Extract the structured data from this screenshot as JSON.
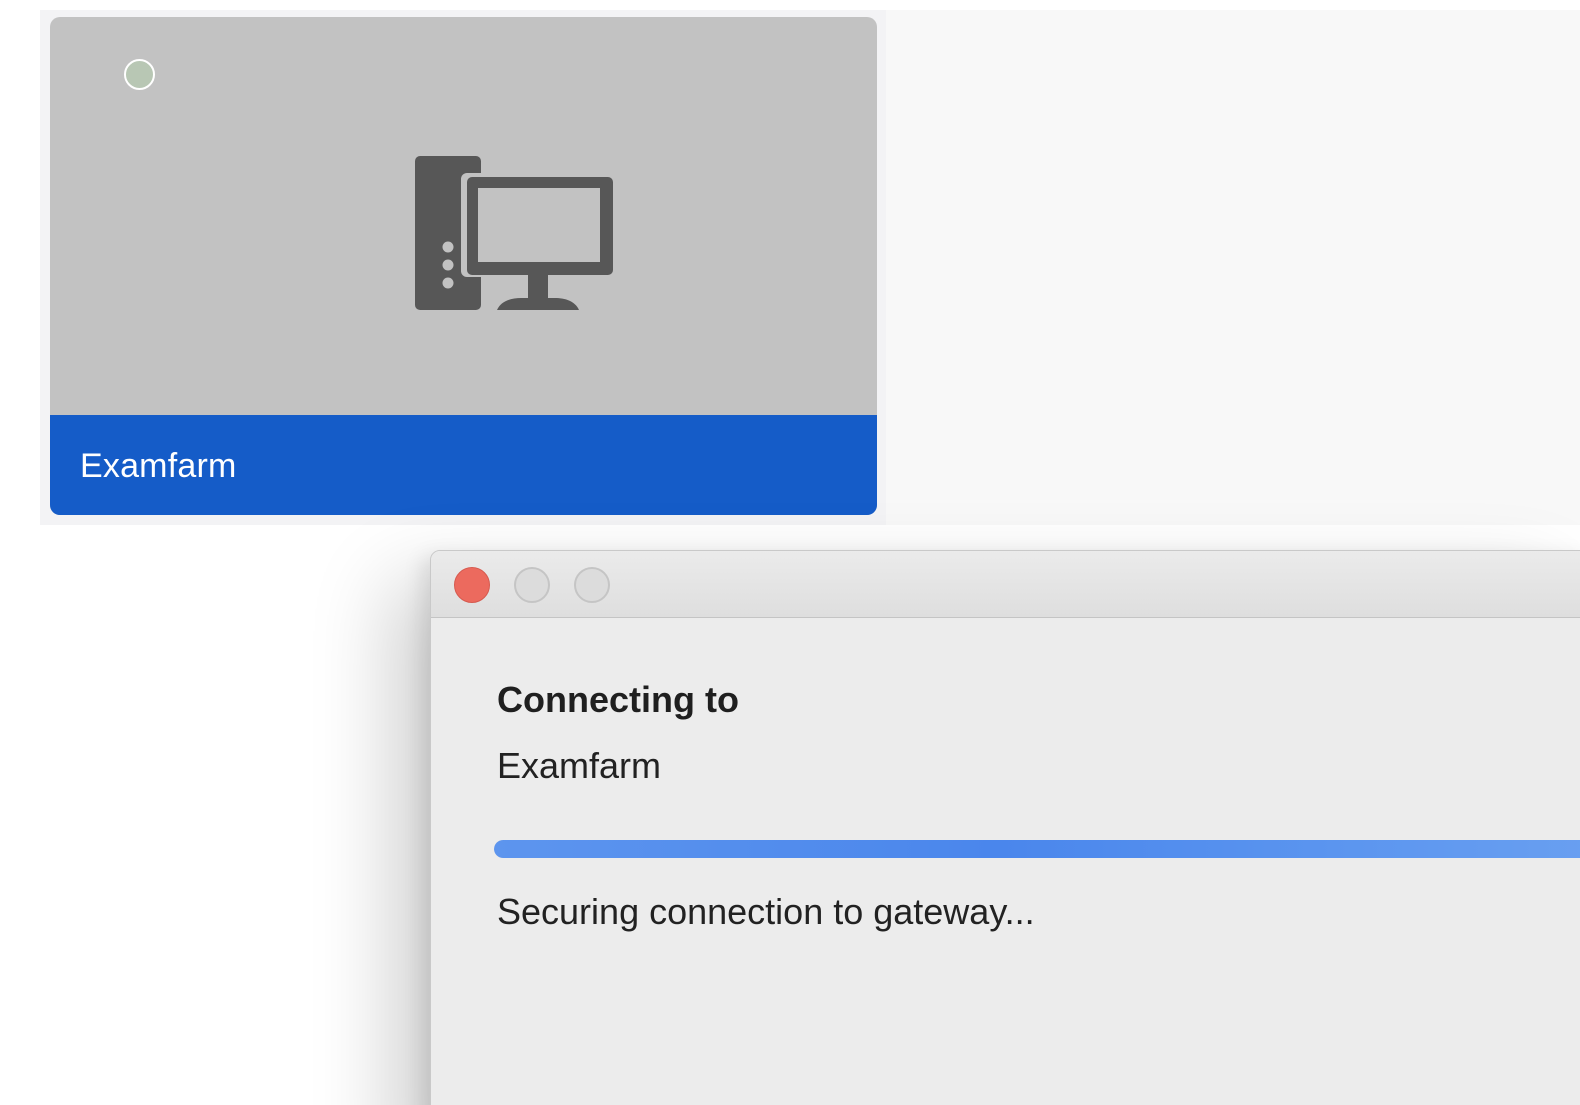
{
  "machine_tile": {
    "name": "Examfarm",
    "status_indicator": "idle",
    "icon": "desktop-computer-icon",
    "colors": {
      "tile_background": "#c2c2c2",
      "footer_background": "#155cc8",
      "status_fill": "#b8c7b4"
    }
  },
  "dialog": {
    "window_controls": [
      "close",
      "minimize",
      "zoom"
    ],
    "heading": "Connecting to",
    "target_name": "Examfarm",
    "progress_fraction": 1.0,
    "status_text": "Securing connection to gateway...",
    "colors": {
      "close_button": "#ec6a5e",
      "progress": "#4a86ec"
    }
  }
}
